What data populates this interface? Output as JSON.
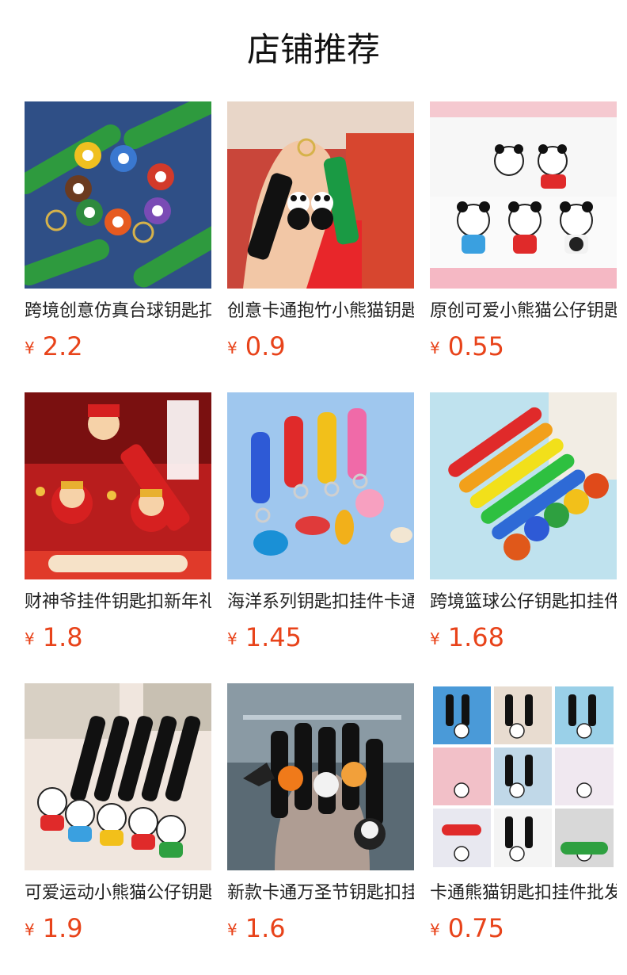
{
  "section": {
    "title": "店铺推荐"
  },
  "products": [
    {
      "name": "跨境创意仿真台球钥匙扣挂件",
      "currency": "¥",
      "price": "2.2",
      "image_icon": "billiard-ball-keychain-icon",
      "bg": "#2f4f86"
    },
    {
      "name": "创意卡通抱竹小熊猫钥匙扣",
      "currency": "¥",
      "price": "0.9",
      "image_icon": "panda-bamboo-keychain-icon",
      "bg": "#c9463a"
    },
    {
      "name": "原创可爱小熊猫公仔钥匙扣",
      "currency": "¥",
      "price": "0.55",
      "image_icon": "panda-doll-keychain-icon",
      "bg": "#f5c9d0"
    },
    {
      "name": "财神爷挂件钥匙扣新年礼品",
      "currency": "¥",
      "price": "1.8",
      "image_icon": "god-of-wealth-keychain-icon",
      "bg": "#b81d1d"
    },
    {
      "name": "海洋系列钥匙扣挂件卡通",
      "currency": "¥",
      "price": "1.45",
      "image_icon": "ocean-animal-keychain-icon",
      "bg": "#9fc7ee"
    },
    {
      "name": "跨境篮球公仔钥匙扣挂件",
      "currency": "¥",
      "price": "1.68",
      "image_icon": "basketball-keychain-icon",
      "bg": "#bfe2ee"
    },
    {
      "name": "可爱运动小熊猫公仔钥匙扣",
      "currency": "¥",
      "price": "1.9",
      "image_icon": "sport-panda-keychain-icon",
      "bg": "#f0e6de"
    },
    {
      "name": "新款卡通万圣节钥匙扣挂件",
      "currency": "¥",
      "price": "1.6",
      "image_icon": "halloween-keychain-icon",
      "bg": "#5a6a74"
    },
    {
      "name": "卡通熊猫钥匙扣挂件批发",
      "currency": "¥",
      "price": "0.75",
      "image_icon": "panda-collage-keychain-icon",
      "bg": "#ededed"
    }
  ]
}
